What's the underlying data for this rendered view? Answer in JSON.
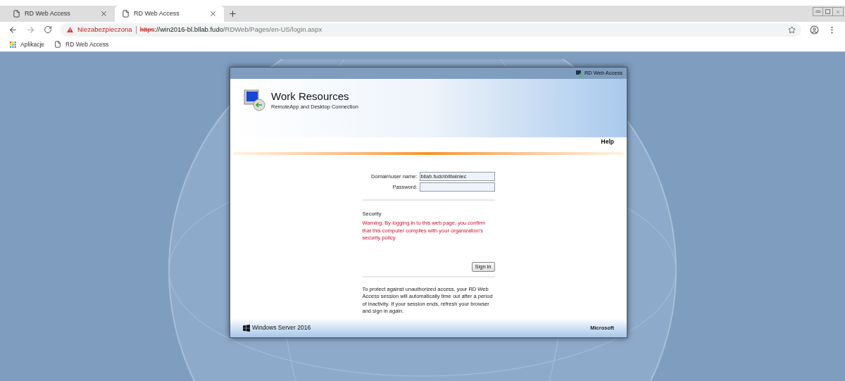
{
  "tabs": [
    {
      "title": "RD Web Access",
      "selected": false
    },
    {
      "title": "RD Web Access",
      "selected": true
    }
  ],
  "address_bar": {
    "security_label": "Niezabezpieczona",
    "url_scheme": "https",
    "url_host": "://win2016-bl.bllab.fudo",
    "url_path": "/RDWeb/Pages/en-US/login.aspx"
  },
  "bookmarks": [
    {
      "kind": "apps",
      "label": "Aplikacje"
    },
    {
      "kind": "page",
      "label": "RD Web Access"
    }
  ],
  "portal": {
    "top_label": "RD Web Access",
    "title": "Work Resources",
    "subtitle": "RemoteApp and Desktop Connection",
    "help": "Help",
    "fields": [
      {
        "label": "Domain\\user name:",
        "value": "bllab.fudo\\blitwiniec"
      },
      {
        "label": "Password:"
      }
    ],
    "security_heading": "Security",
    "warning": "Warning: By logging in to this web page, you confirm that this computer complies with your organization's security policy.",
    "sign_in": "Sign in",
    "notice": "To protect against unauthorized access, your RD Web Access session will automatically time out after a period of inactivity. If your session ends, refresh your browser and sign in again.",
    "footer_left": "Windows Server 2016",
    "footer_right": "Microsoft"
  }
}
